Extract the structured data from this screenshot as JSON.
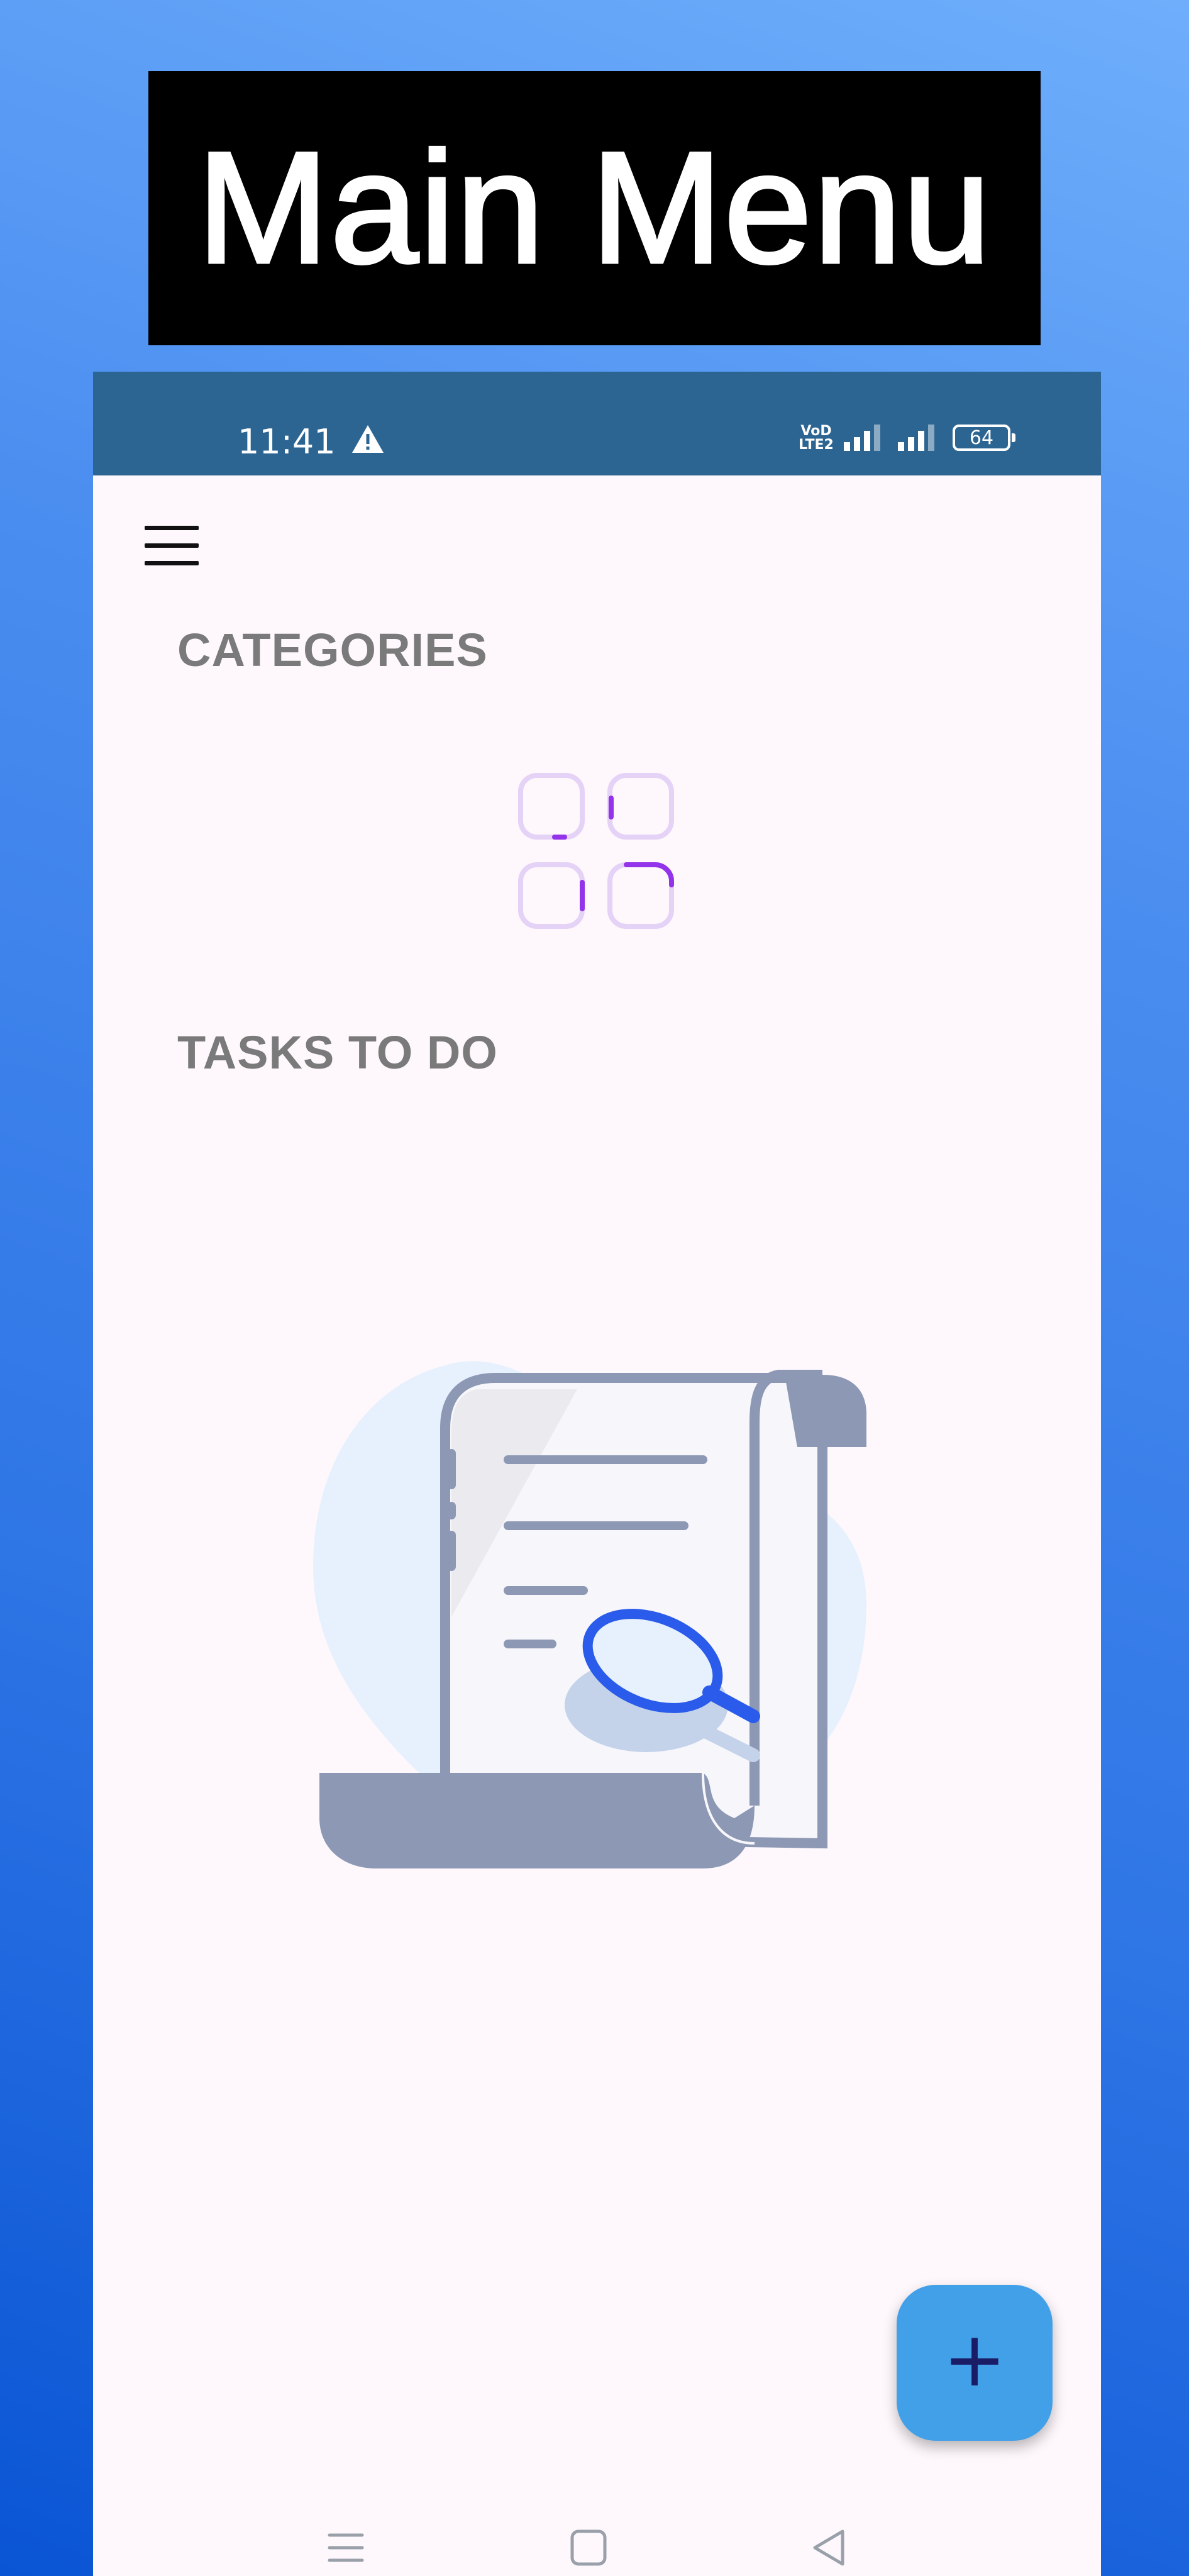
{
  "page_title": "Main Menu",
  "status_bar": {
    "time": "11:41",
    "network_label": "VoD LTE2",
    "battery_level": "64",
    "colors": {
      "background": "#2d6592"
    }
  },
  "app": {
    "menu_icon": "hamburger-menu-icon",
    "categories_heading": "CATEGORIES",
    "categories_loader_icon": "loading-grid-icon",
    "tasks_heading": "TASKS TO DO",
    "empty_state_icon": "scroll-magnifier-illustration",
    "fab_label": "+",
    "colors": {
      "background": "#fef8fc",
      "heading": "#7a7a7a",
      "fab": "#42a0e8",
      "loader_accent": "#9333ea"
    }
  },
  "navigation_bar": {
    "buttons": [
      "recent-apps-icon",
      "home-icon",
      "back-icon"
    ]
  }
}
